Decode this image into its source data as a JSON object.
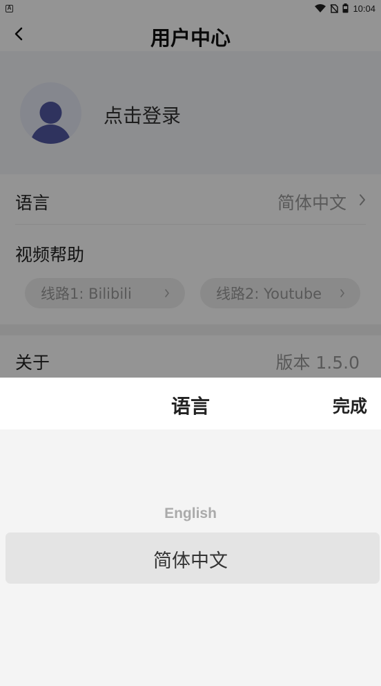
{
  "status_bar": {
    "time": "10:04"
  },
  "header": {
    "title": "用户中心"
  },
  "profile": {
    "login_label": "点击登录"
  },
  "settings": {
    "language": {
      "label": "语言",
      "value": "简体中文"
    },
    "video_help": {
      "label": "视频帮助",
      "routes": [
        {
          "label": "线路1:  Bilibili"
        },
        {
          "label": "线路2: Youtube"
        }
      ]
    },
    "about": {
      "label": "关于",
      "value": "版本 1.5.0"
    }
  },
  "language_sheet": {
    "title": "语言",
    "done_label": "完成",
    "options": [
      "English",
      "简体中文"
    ],
    "selected": "简体中文"
  },
  "colors": {
    "overlay": "rgba(0,0,0,0.42)",
    "sheet_bg": "#f4f4f4",
    "selected_row": "#e4e4e4"
  },
  "icons": [
    "app-a-icon",
    "wifi-icon",
    "no-sim-icon",
    "battery-icon",
    "back-arrow-icon",
    "avatar-icon",
    "chevron-right-icon"
  ]
}
